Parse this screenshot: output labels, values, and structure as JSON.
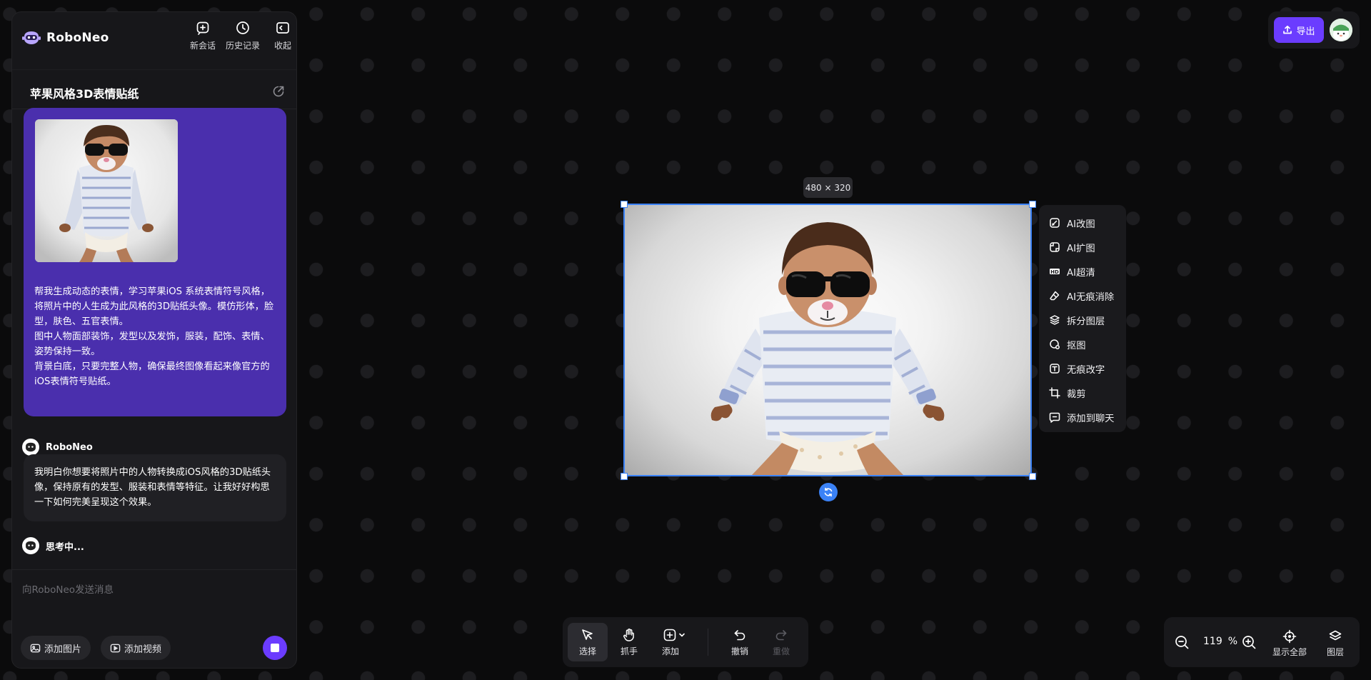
{
  "app": {
    "name": "RoboNeo"
  },
  "header": {
    "new_chat": "新会话",
    "history": "历史记录",
    "collapse": "收起"
  },
  "conversation": {
    "title": "苹果风格3D表情贴纸"
  },
  "messages": {
    "user_text": "帮我生成动态的表情，学习苹果iOS 系统表情符号风格，\n将照片中的人生成为此风格的3D贴纸头像。模仿形体，脸型，肤色、五官表情。\n图中人物面部装饰，发型以及发饰，服装，配饰、表情、姿势保持一致。\n背景白底，只要完整人物，确保最终图像看起来像官方的iOS表情符号贴纸。",
    "bot_name": "RoboNeo",
    "bot_text": "我明白你想要将照片中的人物转换成iOS风格的3D贴纸头像，保持原有的发型、服装和表情等特征。让我好好构思一下如何完美呈现这个效果。",
    "thinking": "思考中..."
  },
  "composer": {
    "placeholder": "向RoboNeo发送消息",
    "add_image": "添加图片",
    "add_video": "添加视频"
  },
  "topbar": {
    "export": "导出"
  },
  "canvas": {
    "dimensions": "480 × 320",
    "context_menu": [
      {
        "label": "AI改图",
        "icon": "ai-edit-icon"
      },
      {
        "label": "AI扩图",
        "icon": "ai-expand-icon"
      },
      {
        "label": "AI超清",
        "icon": "hd-icon"
      },
      {
        "label": "AI无痕消除",
        "icon": "eraser-icon"
      },
      {
        "label": "拆分图层",
        "icon": "layers-split-icon"
      },
      {
        "label": "抠图",
        "icon": "cutout-icon"
      },
      {
        "label": "无痕改字",
        "icon": "text-edit-icon"
      },
      {
        "label": "裁剪",
        "icon": "crop-icon"
      },
      {
        "label": "添加到聊天",
        "icon": "chat-add-icon"
      }
    ]
  },
  "toolbar": {
    "select": "选择",
    "hand": "抓手",
    "add": "添加",
    "undo": "撤销",
    "redo": "重做"
  },
  "zoom": {
    "value": "119",
    "unit": "%",
    "fit_all": "显示全部",
    "layers": "图层"
  },
  "colors": {
    "accent": "#6b3cff",
    "user_bubble": "#4a2fad",
    "selection": "#3b82f6"
  }
}
